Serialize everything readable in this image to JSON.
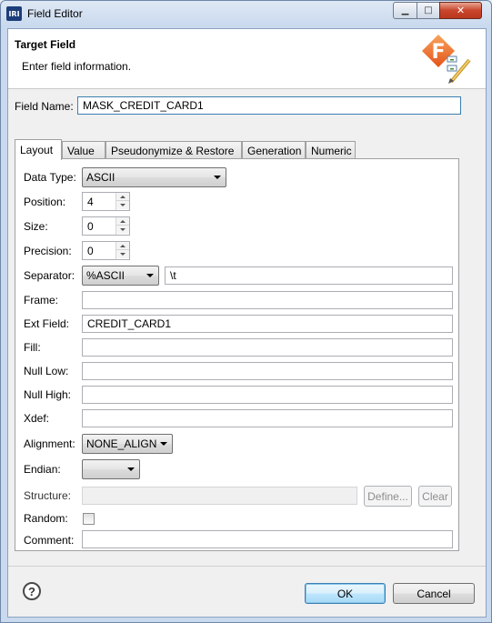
{
  "window": {
    "app_icon_text": "IRI",
    "title": "Field Editor",
    "min_glyph": "▁",
    "max_glyph": "□",
    "close_glyph": "✕"
  },
  "banner": {
    "title": "Target Field",
    "subtitle": "Enter field information.",
    "logo_letter": "F"
  },
  "field_name": {
    "label": "Field Name:",
    "value": "MASK_CREDIT_CARD1"
  },
  "tabs": [
    {
      "label": "Layout",
      "active": true
    },
    {
      "label": "Value"
    },
    {
      "label": "Pseudonymize & Restore"
    },
    {
      "label": "Generation"
    },
    {
      "label": "Numeric"
    }
  ],
  "layout": {
    "data_type": {
      "label": "Data Type:",
      "value": "ASCII"
    },
    "position": {
      "label": "Position:",
      "value": "4"
    },
    "size": {
      "label": "Size:",
      "value": "0"
    },
    "precision": {
      "label": "Precision:",
      "value": "0"
    },
    "separator": {
      "label": "Separator:",
      "combo_value": "%ASCII",
      "value": "\\t"
    },
    "frame": {
      "label": "Frame:",
      "value": ""
    },
    "ext_field": {
      "label": "Ext Field:",
      "value": "CREDIT_CARD1"
    },
    "fill": {
      "label": "Fill:",
      "value": ""
    },
    "null_low": {
      "label": "Null Low:",
      "value": ""
    },
    "null_high": {
      "label": "Null High:",
      "value": ""
    },
    "xdef": {
      "label": "Xdef:",
      "value": ""
    },
    "alignment": {
      "label": "Alignment:",
      "value": "NONE_ALIGN"
    },
    "endian": {
      "label": "Endian:",
      "value": ""
    },
    "structure": {
      "label": "Structure:",
      "value": "",
      "define_label": "Define...",
      "clear_label": "Clear"
    },
    "random": {
      "label": "Random:",
      "checked": false
    },
    "comment": {
      "label": "Comment:",
      "value": ""
    }
  },
  "footer": {
    "help_glyph": "?",
    "ok_label": "OK",
    "cancel_label": "Cancel"
  },
  "colors": {
    "accent": "#3c7fb1",
    "logo_orange": "#f26522",
    "close_red": "#c9452b"
  }
}
